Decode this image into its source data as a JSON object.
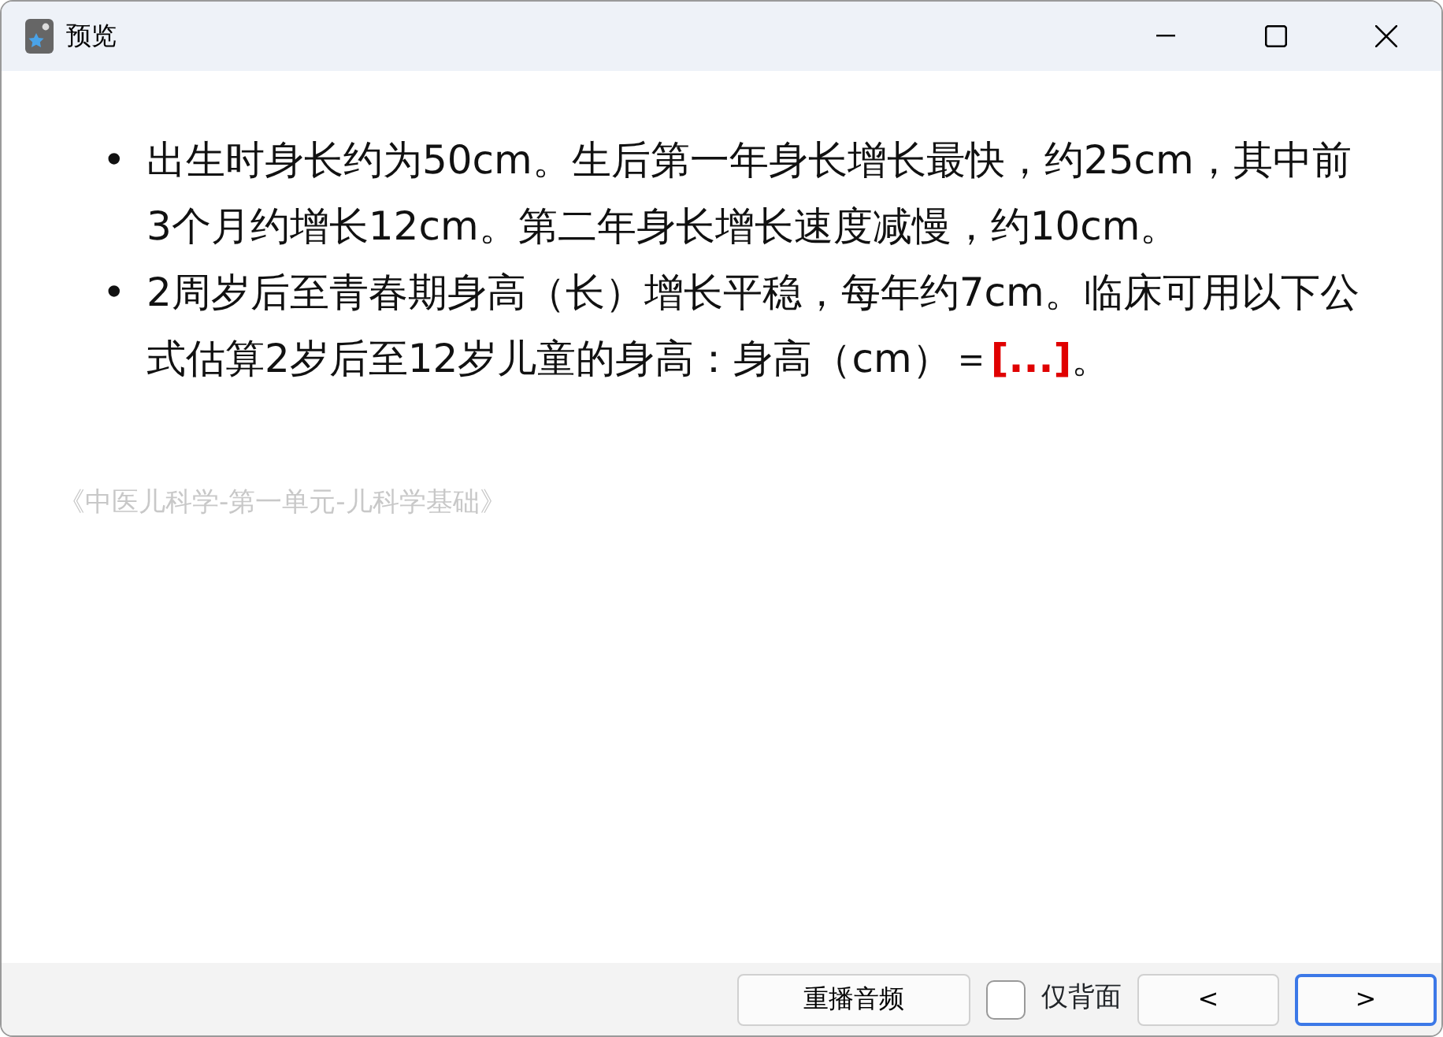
{
  "window": {
    "title": "预览"
  },
  "bullets": [
    {
      "marker": "•",
      "text": "出生时身长约为50cm。生后第一年身长增长最快，约25cm，其中前3个月约增长12cm。第二年身长增长速度减慢，约10cm。"
    },
    {
      "marker": "•",
      "text": "2周岁后至青春期身高（长）增长平稳，每年约7cm。临床可用以下公式估算2岁后至12岁儿童的身高：身高（cm）＝",
      "blank": "[...]",
      "after": "。"
    }
  ],
  "source": "《中医儿科学-第一单元-儿科学基础》",
  "footer": {
    "replay_button": "重播音频",
    "back_only": {
      "label": "仅背面",
      "checked": false
    },
    "prev_button": {
      "label": "<",
      "focused": false
    },
    "next_button": {
      "label": ">",
      "focused": true
    }
  }
}
